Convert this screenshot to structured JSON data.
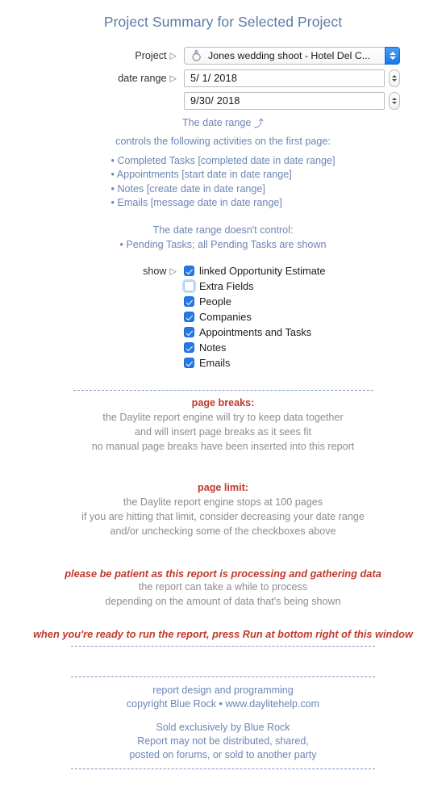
{
  "header": {
    "title": "Project Summary for Selected Project"
  },
  "form": {
    "project": {
      "label": "Project",
      "icon": "ring-icon",
      "value": "Jones wedding shoot - Hotel Del C...",
      "marker": "▷"
    },
    "date_range": {
      "label": "date range",
      "marker": "▷",
      "start": "5/  1/ 2018",
      "end": "9/30/ 2018"
    }
  },
  "info": {
    "heading": "The date range",
    "heading_arrow": "⤴",
    "controls_line": "controls the following activities on the first page:",
    "controlled_items": [
      "• Completed Tasks [completed date in date range]",
      "• Appointments [start date in date range]",
      "• Notes [create date in date range]",
      "• Emails [message date in date range]"
    ],
    "not_controlled_heading": "The date range doesn't control:",
    "not_controlled_items": [
      "• Pending Tasks; all Pending Tasks are shown"
    ]
  },
  "show": {
    "label": "show",
    "marker": "▷",
    "options": [
      {
        "label": "linked Opportunity Estimate",
        "checked": true
      },
      {
        "label": "Extra Fields",
        "checked": false,
        "focused": true
      },
      {
        "label": "People",
        "checked": true
      },
      {
        "label": "Companies",
        "checked": true
      },
      {
        "label": "Appointments and Tasks",
        "checked": true
      },
      {
        "label": "Notes",
        "checked": true
      },
      {
        "label": "Emails",
        "checked": true
      }
    ]
  },
  "page_breaks": {
    "heading": "page breaks:",
    "lines": [
      "the Daylite report engine will try to keep data together",
      "and will insert page breaks as it sees fit",
      "no manual page breaks have been inserted into this report"
    ]
  },
  "page_limit": {
    "heading": "page limit:",
    "lines": [
      "the Daylite report engine stops at 100 pages",
      "if you are hitting that limit, consider decreasing your date range",
      "and/or unchecking some of the checkboxes above"
    ]
  },
  "processing": {
    "notice": "please be patient as this report is processing and gathering data",
    "lines": [
      "the report can take a while to process",
      "depending on the amount of data that's being shown"
    ],
    "run_notice": "when you're ready to run the report, press Run at bottom right of this window"
  },
  "footer": {
    "credits": [
      "report design and programming",
      "copyright Blue Rock • www.daylitehelp.com"
    ],
    "license": [
      "Sold exclusively by Blue Rock",
      "Report may not be distributed, shared,",
      "posted on forums, or sold to another party"
    ]
  },
  "colors": {
    "title_blue": "#5a7ba6",
    "body_blue": "#6b86b4",
    "gray": "#8d8d8d",
    "red": "#c0392b",
    "accent_blue": "#2479e6"
  }
}
